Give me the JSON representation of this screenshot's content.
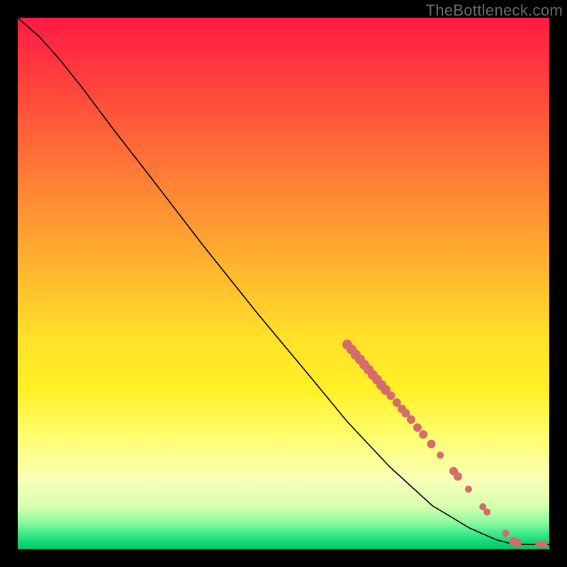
{
  "attribution": "TheBottleneck.com",
  "gradient_colors": {
    "top": "#ff1a44",
    "mid_upper": "#ff7d36",
    "mid": "#ffe02a",
    "mid_lower": "#ffff7a",
    "bottom": "#00c868"
  },
  "chart_data": {
    "type": "line",
    "title": "",
    "xlabel": "",
    "ylabel": "",
    "xlim": [
      0,
      100
    ],
    "ylim": [
      0,
      100
    ],
    "curve": [
      {
        "x": 0,
        "y": 100
      },
      {
        "x": 4,
        "y": 96.5
      },
      {
        "x": 8,
        "y": 92
      },
      {
        "x": 12,
        "y": 87
      },
      {
        "x": 18,
        "y": 79
      },
      {
        "x": 25,
        "y": 70
      },
      {
        "x": 35,
        "y": 57
      },
      {
        "x": 45,
        "y": 44.5
      },
      {
        "x": 55,
        "y": 32.5
      },
      {
        "x": 62,
        "y": 24
      },
      {
        "x": 70,
        "y": 15.5
      },
      {
        "x": 78,
        "y": 8.2
      },
      {
        "x": 85,
        "y": 4
      },
      {
        "x": 90,
        "y": 1.8
      },
      {
        "x": 93,
        "y": 1.0
      },
      {
        "x": 96,
        "y": 0.9
      },
      {
        "x": 98,
        "y": 0.9
      },
      {
        "x": 100,
        "y": 0.9
      }
    ],
    "series": [
      {
        "name": "points",
        "color": "#d66b6b",
        "radius_default": 6,
        "points": [
          {
            "x": 62.0,
            "y": 38.5,
            "r": 7
          },
          {
            "x": 62.8,
            "y": 37.6,
            "r": 7
          },
          {
            "x": 63.6,
            "y": 36.6,
            "r": 7
          },
          {
            "x": 64.4,
            "y": 35.7,
            "r": 7
          },
          {
            "x": 65.2,
            "y": 34.7,
            "r": 7
          },
          {
            "x": 66.0,
            "y": 33.8,
            "r": 7
          },
          {
            "x": 66.8,
            "y": 32.8,
            "r": 7
          },
          {
            "x": 67.6,
            "y": 31.9,
            "r": 7
          },
          {
            "x": 68.4,
            "y": 30.9,
            "r": 7
          },
          {
            "x": 69.2,
            "y": 30.0,
            "r": 7
          },
          {
            "x": 70.2,
            "y": 28.9,
            "r": 6
          },
          {
            "x": 71.3,
            "y": 27.6,
            "r": 6
          },
          {
            "x": 72.3,
            "y": 26.4,
            "r": 6
          },
          {
            "x": 73.0,
            "y": 25.6,
            "r": 6
          },
          {
            "x": 74.0,
            "y": 24.4,
            "r": 6
          },
          {
            "x": 75.2,
            "y": 22.9,
            "r": 6
          },
          {
            "x": 76.3,
            "y": 21.6,
            "r": 6
          },
          {
            "x": 77.8,
            "y": 19.8,
            "r": 6
          },
          {
            "x": 79.5,
            "y": 17.7,
            "r": 5
          },
          {
            "x": 82.0,
            "y": 14.7,
            "r": 6
          },
          {
            "x": 82.8,
            "y": 13.7,
            "r": 6
          },
          {
            "x": 84.8,
            "y": 11.3,
            "r": 5
          },
          {
            "x": 87.5,
            "y": 8.0,
            "r": 5
          },
          {
            "x": 88.3,
            "y": 7.0,
            "r": 5
          },
          {
            "x": 91.8,
            "y": 3.0,
            "r": 5
          },
          {
            "x": 93.2,
            "y": 1.5,
            "r": 6
          },
          {
            "x": 94.0,
            "y": 1.2,
            "r": 6
          },
          {
            "x": 98.0,
            "y": 1.0,
            "r": 5
          },
          {
            "x": 99.0,
            "y": 1.0,
            "r": 5
          }
        ]
      }
    ]
  }
}
